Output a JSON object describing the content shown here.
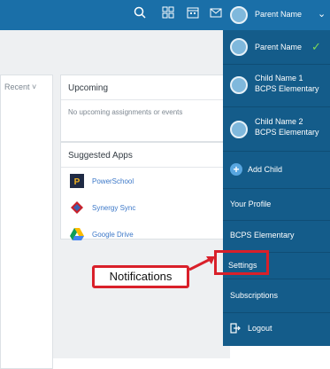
{
  "panel": {
    "header_name": "Parent Name",
    "parent_name": "Parent Name",
    "children": [
      {
        "name": "Child Name 1",
        "school": "BCPS Elementary"
      },
      {
        "name": "Child Name 2",
        "school": "BCPS Elementary"
      }
    ],
    "add_child": "Add Child",
    "your_profile": "Your Profile",
    "school": "BCPS Elementary",
    "settings": "Settings",
    "subscriptions": "Subscriptions",
    "logout": "Logout"
  },
  "main": {
    "recent_label": "Recent",
    "upcoming": {
      "title": "Upcoming",
      "empty_text": "No upcoming assignments or events"
    },
    "suggested_apps": {
      "title": "Suggested Apps",
      "apps": [
        "PowerSchool",
        "Synergy Sync",
        "Google Drive"
      ]
    }
  },
  "callout": {
    "label": "Notifications"
  },
  "colors": {
    "topbar": "#1a6fa8",
    "panel": "#145c8a",
    "highlight": "#d9202a",
    "check": "#7ed957"
  }
}
